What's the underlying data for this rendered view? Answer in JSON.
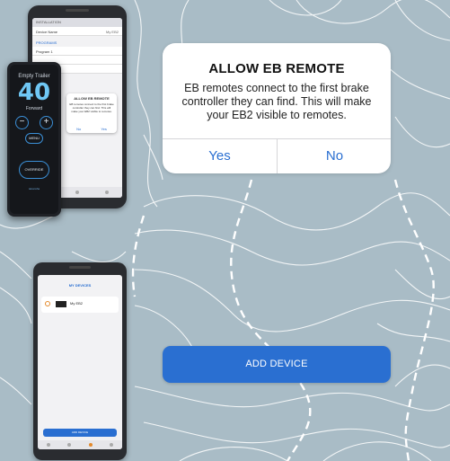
{
  "colors": {
    "background": "#a9bcc6",
    "accent": "#2a6fd1",
    "remote_display": "#6fc7f4",
    "radio_orange": "#e48a2c"
  },
  "alert": {
    "title": "ALLOW EB REMOTE",
    "message": "EB remotes connect to the first brake controller they can find. This will make your EB2 visible to remotes.",
    "yes_label": "Yes",
    "no_label": "No"
  },
  "add_device_button": {
    "label": "ADD DEVICE"
  },
  "phone_installation": {
    "header": "INSTALLATION",
    "device_name_label": "Device Name",
    "device_name_value": "My EB2",
    "section_programs": "PROGRAMS",
    "program_1": "Program 1",
    "mini_dialog": {
      "title": "ALLOW EB REMOTE",
      "text": "EB remotes connect to the first brake controller they can find. This will make your EB2 visible to remotes.",
      "no": "No",
      "yes": "Yes"
    }
  },
  "remote": {
    "mode": "Empty Trailer",
    "value": "40",
    "direction": "Forward",
    "minus": "−",
    "plus": "+",
    "menu": "MENU",
    "override": "OVERRIDE",
    "brand": "tekonsha"
  },
  "phone_devices": {
    "title": "MY DEVICES",
    "device_name": "My EB2",
    "add_button": "ADD DEVICE"
  }
}
